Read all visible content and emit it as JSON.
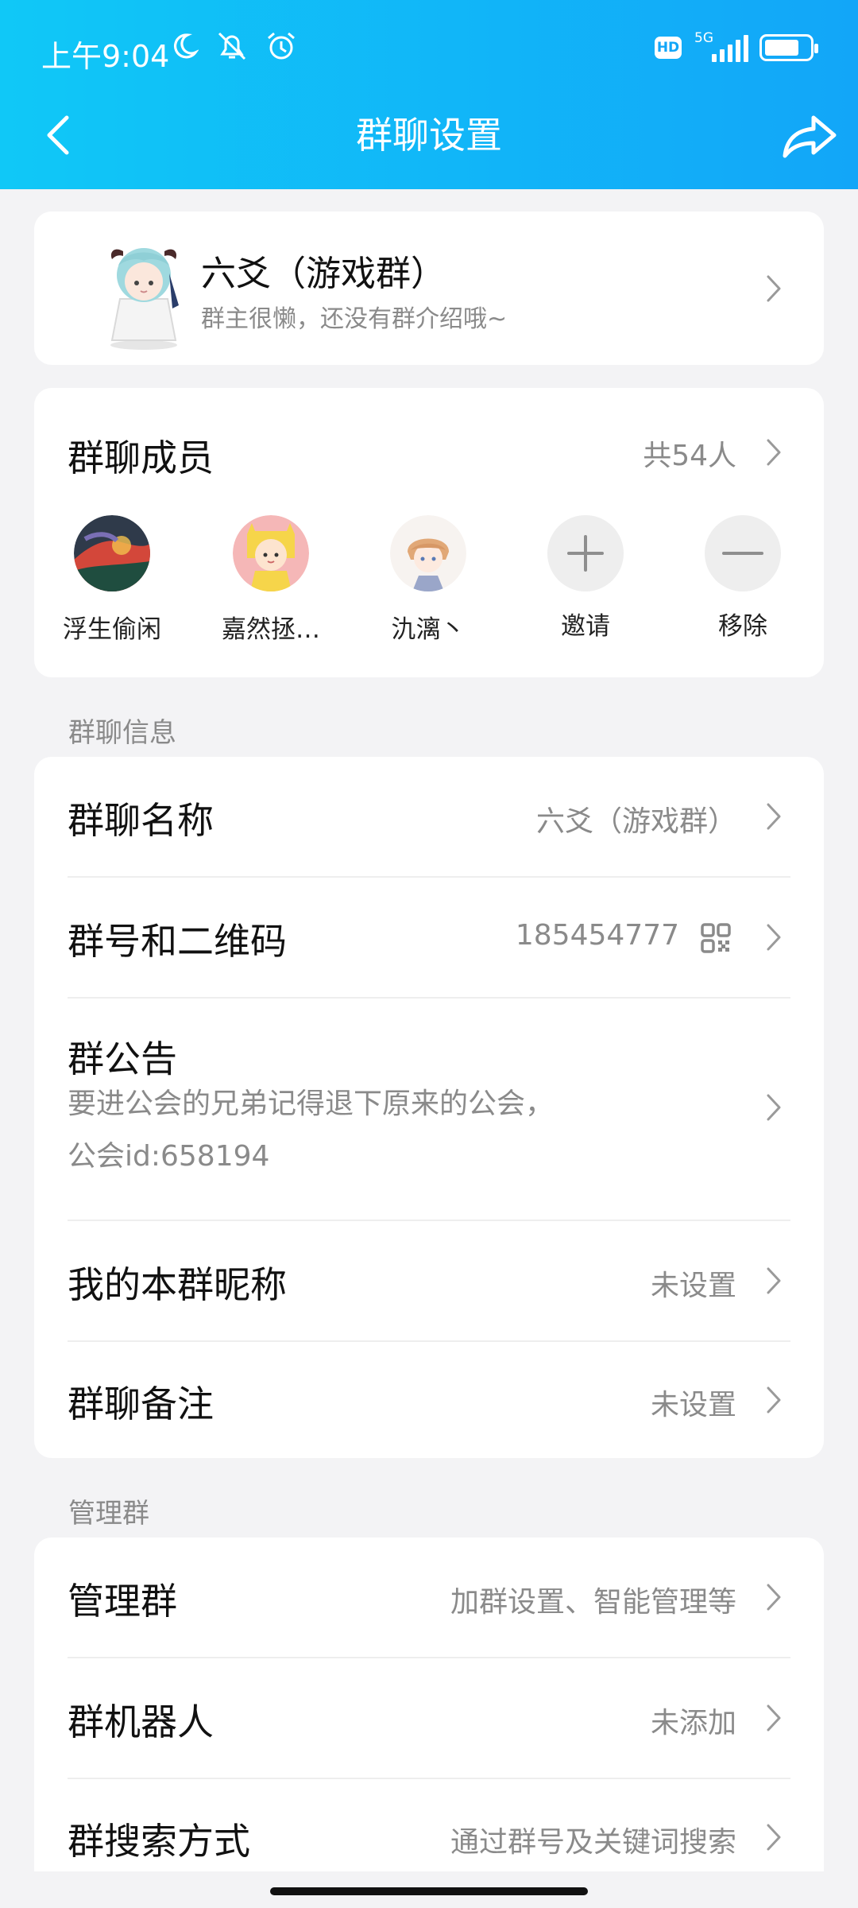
{
  "status_bar": {
    "time": "上午9:04",
    "hd": "HD",
    "network": "5G"
  },
  "header": {
    "title": "群聊设置"
  },
  "group": {
    "name": "六爻（游戏群）",
    "description": "群主很懒，还没有群介绍哦~"
  },
  "members": {
    "title": "群聊成员",
    "count": "共54人",
    "list": [
      {
        "name": "浮生偷闲"
      },
      {
        "name": "嘉然拯…"
      },
      {
        "name": "氿漓丶"
      }
    ],
    "invite_label": "邀请",
    "remove_label": "移除"
  },
  "info_section": {
    "label": "群聊信息",
    "group_name": {
      "label": "群聊名称",
      "value": "六爻（游戏群）"
    },
    "group_id": {
      "label": "群号和二维码",
      "value": "185454777"
    },
    "notice": {
      "label": "群公告",
      "line1": "要进公会的兄弟记得退下原来的公会，",
      "line2": "公会id:658194"
    },
    "nickname": {
      "label": "我的本群昵称",
      "value": "未设置"
    },
    "remark": {
      "label": "群聊备注",
      "value": "未设置"
    }
  },
  "manage_section": {
    "label": "管理群",
    "manage": {
      "label": "管理群",
      "value": "加群设置、智能管理等"
    },
    "robot": {
      "label": "群机器人",
      "value": "未添加"
    },
    "search": {
      "label": "群搜索方式",
      "value": "通过群号及关键词搜索"
    }
  },
  "colors": {
    "header_start": "#10c8f7",
    "header_end": "#12a6f8",
    "background": "#f3f3f5",
    "secondary_text": "#8a8a8a"
  }
}
